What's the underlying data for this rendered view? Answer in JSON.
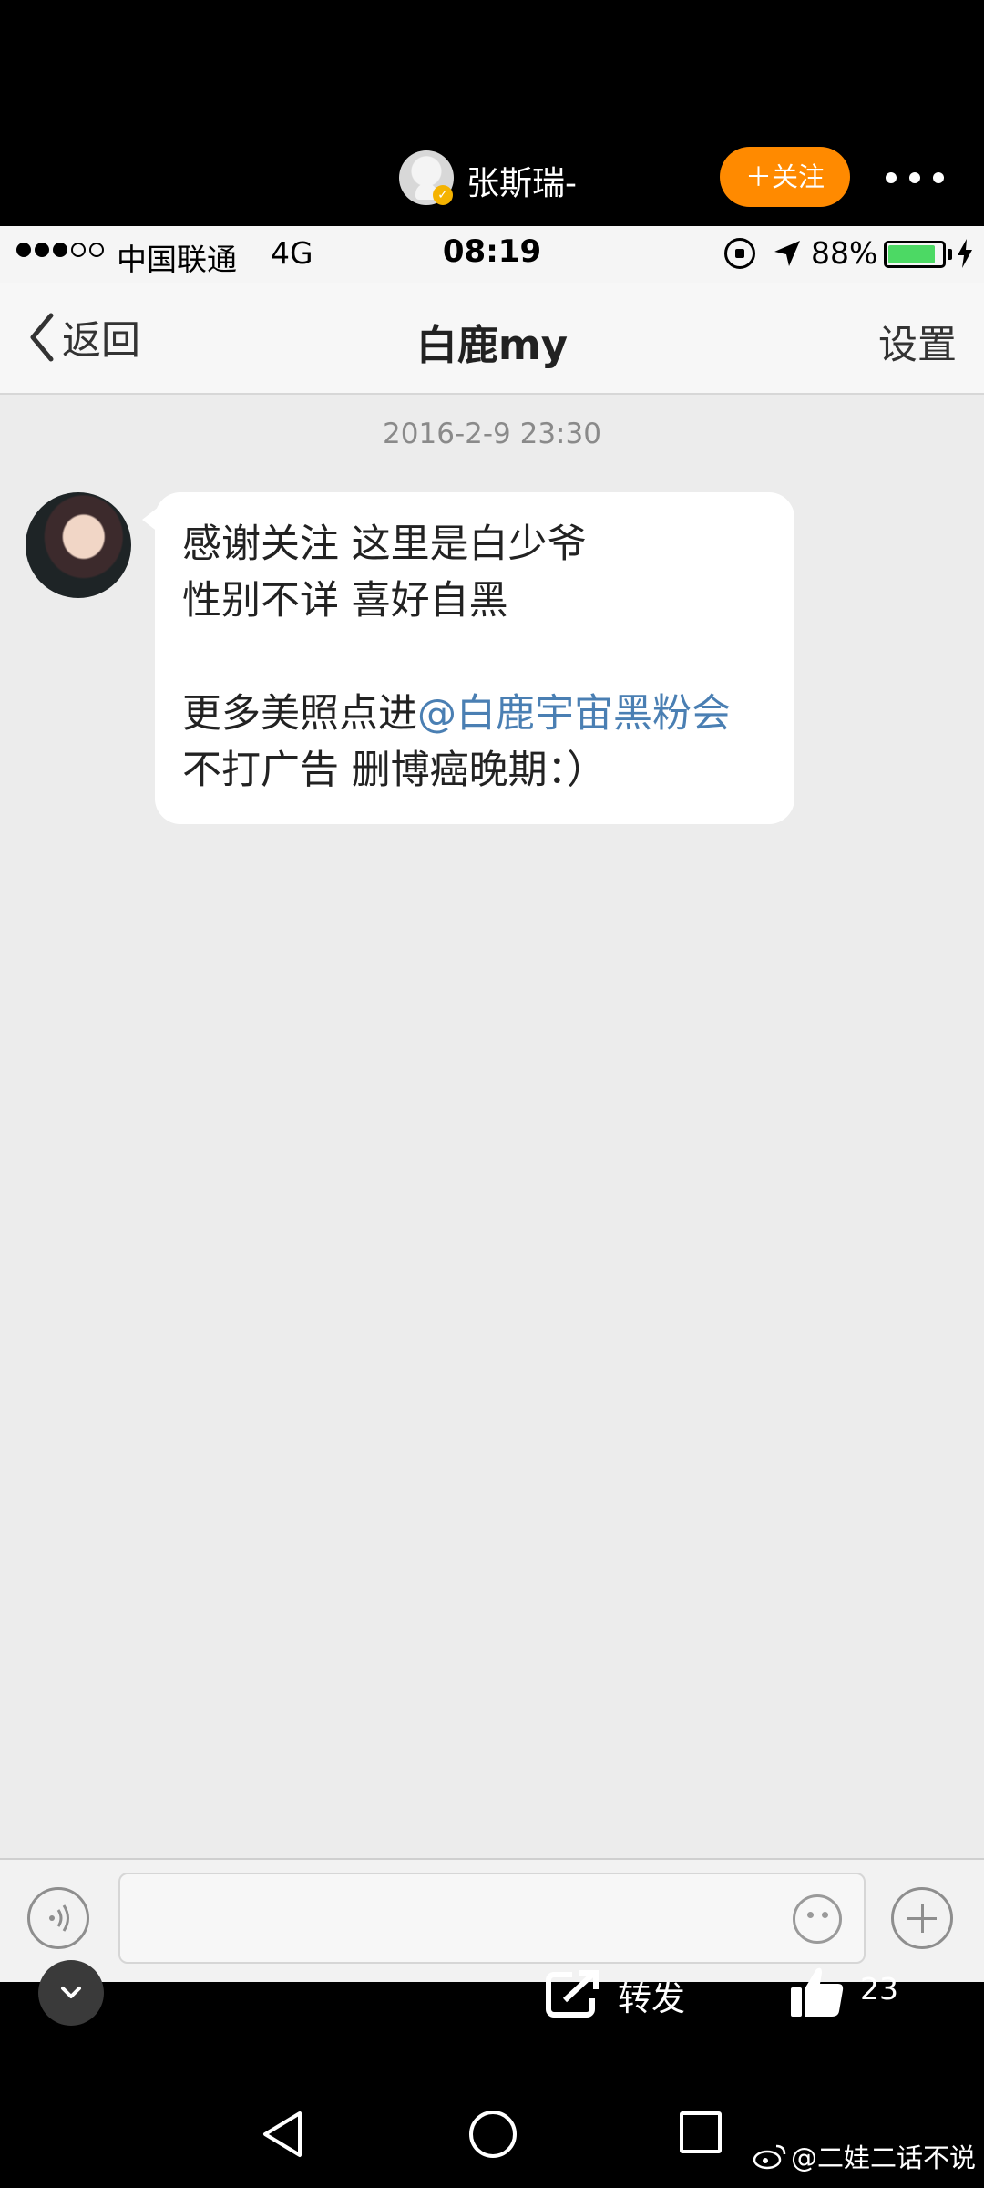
{
  "weibo_post": {
    "author_name": "张斯瑞-",
    "follow_label": "＋关注",
    "repost_label": "转发",
    "like_count": "23",
    "watermark": "@二娃二话不说"
  },
  "phone_status": {
    "carrier": "中国联通",
    "network": "4G",
    "time": "08:19",
    "battery": "88%"
  },
  "chat": {
    "back_label": "返回",
    "title": "白鹿my",
    "settings_label": "设置",
    "timestamp": "2016-2-9 23:30",
    "message": {
      "line1": "感谢关注 这里是白少爷",
      "line2": "性别不详 喜好自黑",
      "line3_prefix": "更多美照点进",
      "line3_mention": "@白鹿宇宙黑粉会",
      "line4": "不打广告 删博癌晚期：）"
    }
  },
  "colors": {
    "follow_button": "#ff8a00",
    "mention_link": "#4a7fb3",
    "battery_fill": "#4cd964",
    "verified_badge": "#f5b300"
  },
  "icons": [
    "verified-icon",
    "more-icon",
    "location-icon",
    "lock-rotation-icon",
    "battery-icon",
    "charging-icon",
    "back-chevron-icon",
    "voice-icon",
    "emoji-icon",
    "plus-icon",
    "chevron-down-icon",
    "repost-icon",
    "like-icon",
    "weibo-logo-icon"
  ]
}
